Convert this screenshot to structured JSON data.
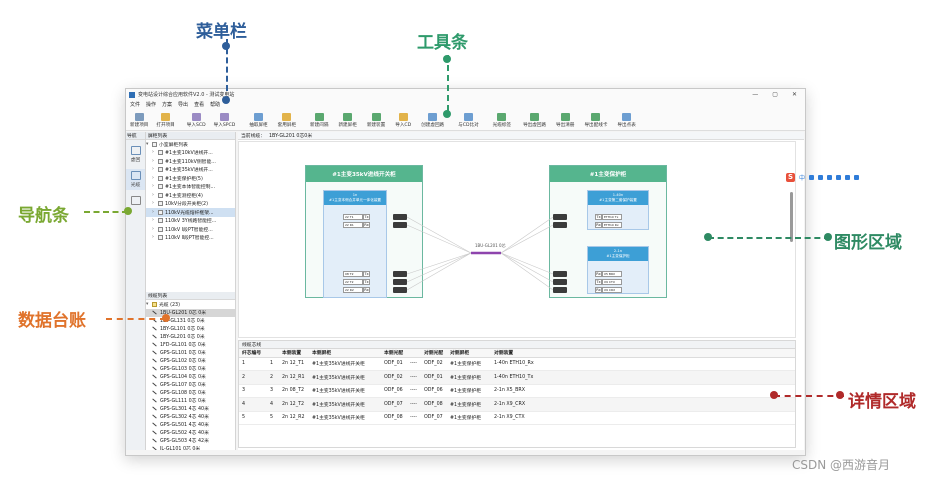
{
  "callouts": {
    "menu": "菜单栏",
    "toolbar": "工具条",
    "nav": "导航条",
    "data": "数据台账",
    "graph": "图形区域",
    "detail": "详情区域"
  },
  "colors": {
    "menu": "#2e5e9a",
    "toolbar": "#2e9a6b",
    "nav": "#7aa832",
    "data": "#e0732b",
    "graph": "#2e8a63",
    "detail": "#b02a2a"
  },
  "window": {
    "title": "变电站设计综合应用软件V2.0 - 测试变电站",
    "controls": [
      "—",
      "▢",
      "✕"
    ]
  },
  "menu": [
    "文件",
    "操作",
    "方案",
    "导出",
    "查看",
    "帮助"
  ],
  "toolbar": [
    {
      "label": "新建项目",
      "icon": "new-project-icon",
      "color": "#7d9bbd"
    },
    {
      "label": "打开项目",
      "icon": "open-project-icon",
      "color": "#e2b34a"
    },
    {
      "label": "导入SCD",
      "icon": "import-scd-icon",
      "color": "#9b8bc4"
    },
    {
      "label": "导入SPCD",
      "icon": "import-spcd-icon",
      "color": "#9b8bc4"
    },
    {
      "label": "抽取屏柜",
      "icon": "extract-cabinet-icon",
      "color": "#6d9ed1"
    },
    {
      "label": "套用屏柜",
      "icon": "apply-cabinet-icon",
      "color": "#e2b34a"
    },
    {
      "label": "新建间隔",
      "icon": "new-bay-icon",
      "color": "#5aa86f"
    },
    {
      "label": "新建屏柜",
      "icon": "new-cabinet-icon",
      "color": "#5aa86f"
    },
    {
      "label": "新建装置",
      "icon": "new-device-icon",
      "color": "#5aa86f"
    },
    {
      "label": "导入CD",
      "icon": "import-cd-icon",
      "color": "#e2b34a"
    },
    {
      "label": "创建虚回路",
      "icon": "create-virtual-loop-icon",
      "color": "#6d9ed1"
    },
    {
      "label": "与CD比对",
      "icon": "compare-cd-icon",
      "color": "#6d9ed1"
    },
    {
      "label": "光缆标签",
      "icon": "cable-label-icon",
      "color": "#5aa86f"
    },
    {
      "label": "导出虚回路",
      "icon": "export-virtual-loop-icon",
      "color": "#5aa86f"
    },
    {
      "label": "导出清册",
      "icon": "export-list-icon",
      "color": "#5aa86f"
    },
    {
      "label": "导出配线卡",
      "icon": "export-wiring-card-icon",
      "color": "#5aa86f"
    },
    {
      "label": "导出点表",
      "icon": "export-point-table-icon",
      "color": "#6d9ed1"
    }
  ],
  "nav": {
    "header_a": "导航",
    "header_b": "屏柜列表",
    "items": [
      {
        "label": "虚回",
        "icon": "virtual-loop-icon"
      },
      {
        "label": "光缆",
        "icon": "cable-icon"
      },
      {
        "label": "",
        "icon": "document-icon"
      }
    ]
  },
  "tree": {
    "root": "小室屏柜列表",
    "items": [
      "#1主变10kV进线开...",
      "#1主变110kV侧智能...",
      "#1主变35kV进线开...",
      "#1主变保护柜(5)",
      "#1主变本体智能控制...",
      "#1主变测控柜(4)",
      "10kV分段开关柜(2)",
      "110kV光缆熔纤框架...",
      "110kV 3Y线路智能控...",
      "110kV Ⅰ段PT智能控...",
      "110kV Ⅱ段PT智能控..."
    ],
    "selected_index": 7
  },
  "cable_list": {
    "header": "线缆列表",
    "group": "光缆 (23)",
    "items": [
      "1BU-GL201 0芯 0米",
      "1BY-GL131 0芯 0米",
      "1BY-GL101 0芯 0米",
      "1BY-GL201 0芯 0米",
      "1FD-GL101 0芯 0米",
      "GPS-GL101 0芯 0米",
      "GPS-GL102 0芯 0米",
      "GPS-GL103 0芯 0米",
      "GPS-GL104 0芯 0米",
      "GPS-GL107 0芯 0米",
      "GPS-GL108 0芯 0米",
      "GPS-GL111 0芯 0米",
      "GPS-GL301 4芯 40米",
      "GPS-GL302 4芯 40米",
      "GPS-GL501 4芯 40米",
      "GPS-GL502 4芯 40米",
      "GPS-GL503 4芯 42米",
      "JL-GL101 0芯 0米",
      "JL-GL102 0芯 0米",
      "JL-GL103 0芯 0米",
      "GPS-GL105 0芯 0米"
    ],
    "selected_index": 0
  },
  "breadcrumb": {
    "label": "当前线缆：",
    "value": "1BY-GL201  0芯0米"
  },
  "graph": {
    "left_cabinet": "#1主变35kV进线开关柜",
    "right_cabinet": "#1主变保护柜",
    "left_unit": "1n\n#1主变本侧合并单元一体化装置",
    "right_unit_a": "1-40n\n#1主变第二套保护装置",
    "right_unit_b": "2-1n\n#1主变保护柜",
    "center": "1BU-GL201  0芯",
    "left_ports": [
      {
        "num": "22 T1",
        "tx": "Tx"
      },
      {
        "num": "22 R1",
        "tx": "Rx"
      },
      {
        "num": "08 T2",
        "tx": "Tx"
      },
      {
        "num": "22 T2",
        "tx": "Tx"
      },
      {
        "num": "22 R2",
        "tx": "Rx"
      }
    ],
    "right_ports": [
      {
        "num": "Tx",
        "name": "ETH10 Tx"
      },
      {
        "num": "Rx",
        "name": "ETH10 Rx"
      },
      {
        "num": "Rx",
        "name": "X5 BRX"
      },
      {
        "num": "Tx",
        "name": "X9 CTX"
      },
      {
        "num": "Rx",
        "name": "X9 CRX"
      }
    ]
  },
  "detail": {
    "title": "线缆芯线",
    "columns": [
      "纤芯编号",
      "本侧装置",
      "本侧屏柜",
      "本侧光配",
      "",
      "对侧光配",
      "对侧屏柜",
      "对侧装置"
    ],
    "rows": [
      [
        "1",
        "1",
        "2n 12_T1",
        "#1主变35kV进线开关柜",
        "ODF_01",
        "----",
        "ODF_02",
        "#1主变保护柜",
        "1-40n ETH10_Rx"
      ],
      [
        "2",
        "2",
        "2n 12_R1",
        "#1主变35kV进线开关柜",
        "ODF_02",
        "----",
        "ODF_01",
        "#1主变保护柜",
        "1-40n ETH10_Tx"
      ],
      [
        "3",
        "3",
        "2n 08_T2",
        "#1主变35kV进线开关柜",
        "ODF_06",
        "----",
        "ODF_06",
        "#1主变保护柜",
        "2-1n X5_BRX"
      ],
      [
        "4",
        "4",
        "2n 12_T2",
        "#1主变35kV进线开关柜",
        "ODF_07",
        "----",
        "ODF_08",
        "#1主变保护柜",
        "2-1n X9_CRX"
      ],
      [
        "5",
        "5",
        "2n 12_R2",
        "#1主变35kV进线开关柜",
        "ODF_08",
        "----",
        "ODF_07",
        "#1主变保护柜",
        "2-1n X9_CTX"
      ]
    ]
  },
  "ime": {
    "logo": "S",
    "lang": "中"
  },
  "watermark": "CSDN @西游音月"
}
